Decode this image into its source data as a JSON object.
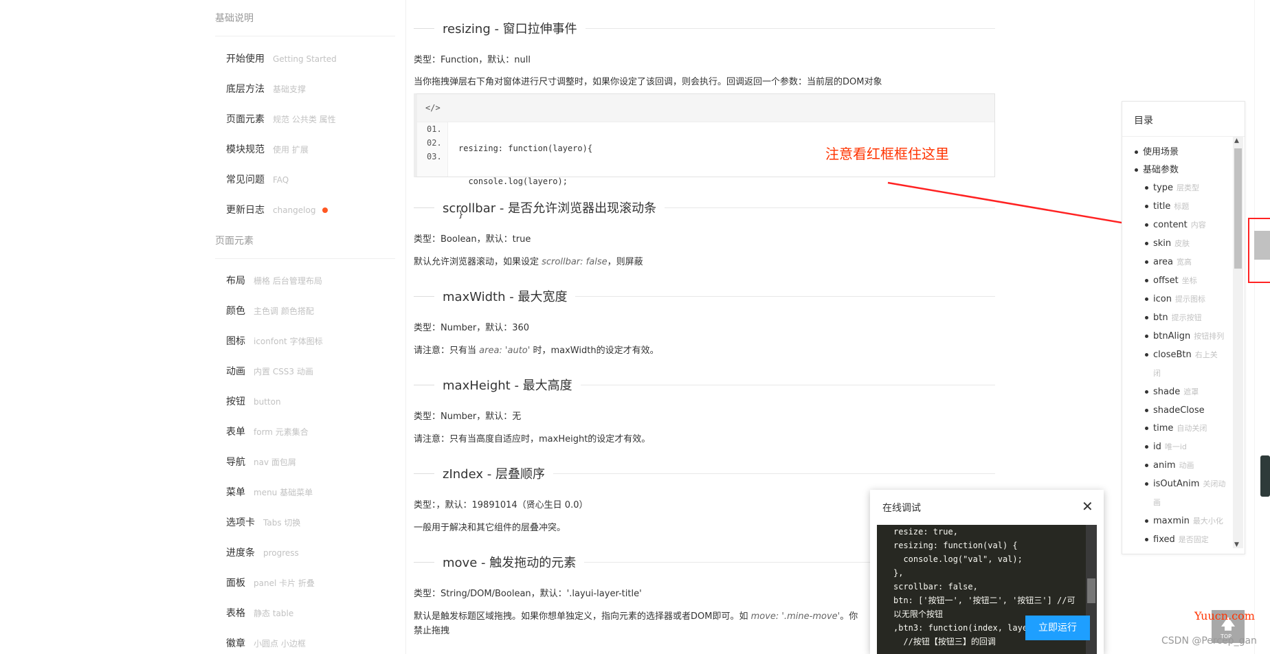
{
  "sidebar": {
    "sections": [
      {
        "title": "基础说明"
      },
      {
        "title": "页面元素"
      }
    ],
    "items": [
      {
        "label": "开始使用",
        "sub": "Getting Started"
      },
      {
        "label": "底层方法",
        "sub": "基础支撑"
      },
      {
        "label": "页面元素",
        "sub": "规范 公共类 属性"
      },
      {
        "label": "模块规范",
        "sub": "使用 扩展"
      },
      {
        "label": "常见问题",
        "sub": "FAQ"
      },
      {
        "label": "更新日志",
        "sub": "changelog"
      },
      {
        "label": "布局",
        "sub": "栅格 后台管理布局"
      },
      {
        "label": "颜色",
        "sub": "主色调 颜色搭配"
      },
      {
        "label": "图标",
        "sub": "iconfont 字体图标"
      },
      {
        "label": "动画",
        "sub": "内置 CSS3 动画"
      },
      {
        "label": "按钮",
        "sub": "button"
      },
      {
        "label": "表单",
        "sub": "form 元素集合"
      },
      {
        "label": "导航",
        "sub": "nav 面包屑"
      },
      {
        "label": "菜单",
        "sub": "menu 基础菜单"
      },
      {
        "label": "选项卡",
        "sub": "Tabs 切换"
      },
      {
        "label": "进度条",
        "sub": "progress"
      },
      {
        "label": "面板",
        "sub": "panel 卡片 折叠"
      },
      {
        "label": "表格",
        "sub": "静态 table"
      },
      {
        "label": "徽章",
        "sub": "小圆点 小边框"
      }
    ]
  },
  "main": {
    "resizing": {
      "heading": "resizing - 窗口拉伸事件",
      "type": "类型：Function，默认：null",
      "desc": "当你拖拽弹层右下角对窗体进行尺寸调整时，如果你设定了该回调，则会执行。回调返回一个参数：当前层的DOM对象",
      "code_head": "</>",
      "line_numbers": [
        "01.",
        "02.",
        "03."
      ],
      "code_lines": [
        "resizing: function(layero){",
        "  console.log(layero);",
        "}"
      ]
    },
    "scrollbar": {
      "heading": "scrollbar - 是否允许浏览器出现滚动条",
      "type": "类型：Boolean，默认：true",
      "desc_a": "默认允许浏览器滚动，如果设定 ",
      "desc_code": "scrollbar: false",
      "desc_b": "，则屏蔽"
    },
    "maxWidth": {
      "heading": "maxWidth - 最大宽度",
      "type": "类型：Number，默认：360",
      "desc_a": "请注意：只有当 ",
      "desc_code": "area: 'auto'",
      "desc_b": " 时，maxWidth的设定才有效。"
    },
    "maxHeight": {
      "heading": "maxHeight - 最大高度",
      "type": "类型：Number，默认：无",
      "desc": "请注意：只有当高度自适应时，maxHeight的设定才有效。"
    },
    "zIndex": {
      "heading": "zIndex - 层叠顺序",
      "type": "类型：，默认：19891014（贤心生日 0.0）",
      "desc": "一般用于解决和其它组件的层叠冲突。"
    },
    "move": {
      "heading": "move - 触发拖动的元素",
      "type": "类型：String/DOM/Boolean，默认：'.layui-layer-title'",
      "desc_a": "默认是触发标题区域拖拽。如果你想单独定义，指向元素的选择器或者DOM即可。如 ",
      "desc_code": "move: '.mine-move'",
      "desc_b": "。你",
      "desc_line2": "禁止拖拽"
    },
    "annotation": "注意看红框框住这里"
  },
  "toc": {
    "title": "目录",
    "items": [
      {
        "label": "使用场景",
        "sub": "",
        "level": 1
      },
      {
        "label": "基础参数",
        "sub": "",
        "level": 1
      },
      {
        "label": "type",
        "sub": "层类型",
        "level": 2
      },
      {
        "label": "title",
        "sub": "标题",
        "level": 2
      },
      {
        "label": "content",
        "sub": "内容",
        "level": 2
      },
      {
        "label": "skin",
        "sub": "皮肤",
        "level": 2
      },
      {
        "label": "area",
        "sub": "宽高",
        "level": 2
      },
      {
        "label": "offset",
        "sub": "坐标",
        "level": 2
      },
      {
        "label": "icon",
        "sub": "提示图标",
        "level": 2
      },
      {
        "label": "btn",
        "sub": "提示按钮",
        "level": 2
      },
      {
        "label": "btnAlign",
        "sub": "按钮排列",
        "level": 2
      },
      {
        "label": "closeBtn",
        "sub": "右上关",
        "sub2": "闭",
        "level": 2
      },
      {
        "label": "shade",
        "sub": "遮罩",
        "level": 2
      },
      {
        "label": "shadeClose",
        "sub": "",
        "level": 2
      },
      {
        "label": "time",
        "sub": "自动关闭",
        "level": 2
      },
      {
        "label": "id",
        "sub": "唯一id",
        "level": 2
      },
      {
        "label": "anim",
        "sub": "动画",
        "level": 2
      },
      {
        "label": "isOutAnim",
        "sub": "关闭动",
        "sub2": "画",
        "level": 2
      },
      {
        "label": "maxmin",
        "sub": "最大小化",
        "level": 2
      },
      {
        "label": "fixed",
        "sub": "是否固定",
        "level": 2
      }
    ]
  },
  "debug": {
    "title": "在线调试",
    "close": "✕",
    "code": "resize: true,\nresizing: function(val) {\n  console.log(\"val\", val);\n},\nscrollbar: false,\nbtn: ['按钮一', '按钮二', '按钮三'] //可\n以无限个按钮\n,btn3: function(index, layer\n  //按钮【按钮三】的回调",
    "run_label": "立即运行"
  },
  "watermark": {
    "site": "Yuucn.com",
    "csdn": "CSDN @Percep_gan",
    "top": "TOP"
  },
  "colors": {
    "accent_blue": "#1e9fff",
    "annotation_red": "#ff3300",
    "changelog_dot": "#ff5722"
  }
}
